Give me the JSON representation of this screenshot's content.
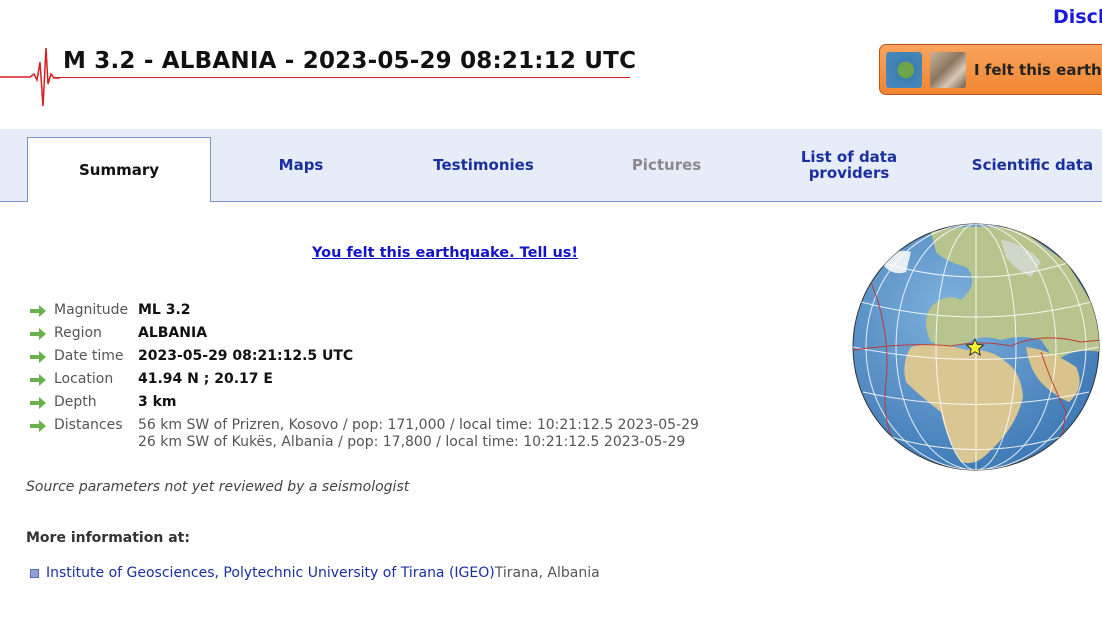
{
  "header": {
    "disclaimer": "Discl",
    "title": "M 3.2 - ALBANIA - 2023-05-29 08:21:12 UTC",
    "felt_button": "I felt this earth"
  },
  "tabs": [
    {
      "label": "Summary",
      "state": "active"
    },
    {
      "label": "Maps",
      "state": "normal"
    },
    {
      "label": "Testimonies",
      "state": "normal"
    },
    {
      "label": "Pictures",
      "state": "disabled"
    },
    {
      "label": "List of data providers",
      "state": "normal"
    },
    {
      "label": "Scientific data",
      "state": "normal"
    }
  ],
  "tell_us_link": "You felt this earthquake. Tell us!",
  "parameters": {
    "magnitude": {
      "label": "Magnitude",
      "value": "ML 3.2"
    },
    "region": {
      "label": "Region",
      "value": "ALBANIA"
    },
    "datetime": {
      "label": "Date time",
      "value": "2023-05-29 08:21:12.5 UTC"
    },
    "location": {
      "label": "Location",
      "value": "41.94 N ; 20.17 E"
    },
    "depth": {
      "label": "Depth",
      "value": "3 km"
    },
    "distances": {
      "label": "Distances",
      "lines": [
        "56 km SW of Prizren, Kosovo / pop: 171,000 / local time: 10:21:12.5 2023-05-29",
        "26 km SW of Kukës, Albania / pop: 17,800 / local time: 10:21:12.5 2023-05-29"
      ]
    }
  },
  "source_note": "Source parameters not yet reviewed by a seismologist",
  "more_info": {
    "heading": "More information at:",
    "link": "Institute of Geosciences, Polytechnic University of Tirana (IGEO)",
    "location": " Tirana, Albania"
  },
  "colors": {
    "accent_link": "#1b2fa0",
    "title_underline": "#d81e1e",
    "felt_button": "#f08530",
    "tab_bar": "#e6ecf8",
    "arrow": "#6ab04c"
  },
  "icons": {
    "param_arrow": "green-arrow-icon",
    "seismogram": "seismogram-icon",
    "epicenter": "star-icon"
  }
}
